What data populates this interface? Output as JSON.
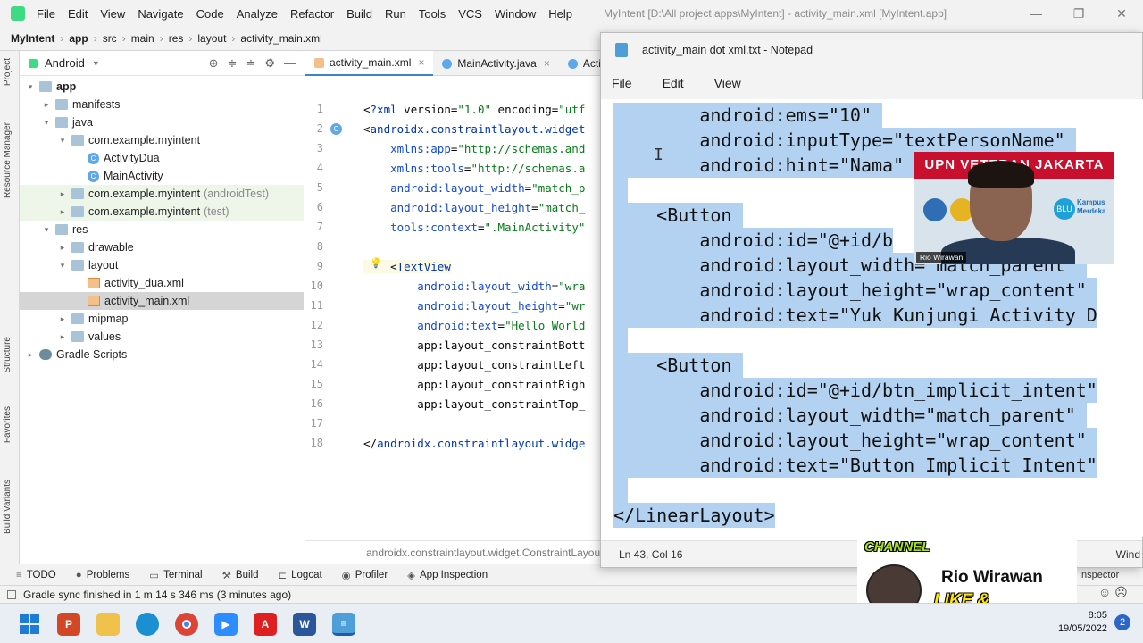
{
  "ide": {
    "menu": [
      "File",
      "Edit",
      "View",
      "Navigate",
      "Code",
      "Analyze",
      "Refactor",
      "Build",
      "Run",
      "Tools",
      "VCS",
      "Window",
      "Help"
    ],
    "window_title": "MyIntent [D:\\All project apps\\MyIntent] - activity_main.xml [MyIntent.app]",
    "breadcrumb": [
      "MyIntent",
      "app",
      "src",
      "main",
      "res",
      "layout",
      "activity_main.xml"
    ],
    "project_view": "Android",
    "tree": [
      {
        "label": "app",
        "depth": 0,
        "arrow": "▾",
        "icon": "folder",
        "bold": true
      },
      {
        "label": "manifests",
        "depth": 1,
        "arrow": "▸",
        "icon": "folder"
      },
      {
        "label": "java",
        "depth": 1,
        "arrow": "▾",
        "icon": "folder"
      },
      {
        "label": "com.example.myintent",
        "depth": 2,
        "arrow": "▾",
        "icon": "folder"
      },
      {
        "label": "ActivityDua",
        "depth": 3,
        "arrow": "",
        "icon": "class"
      },
      {
        "label": "MainActivity",
        "depth": 3,
        "arrow": "",
        "icon": "class"
      },
      {
        "label": "com.example.myintent",
        "suffix": "(androidTest)",
        "depth": 2,
        "arrow": "▸",
        "icon": "folder",
        "hl": true
      },
      {
        "label": "com.example.myintent",
        "suffix": "(test)",
        "depth": 2,
        "arrow": "▸",
        "icon": "folder",
        "hl": true
      },
      {
        "label": "res",
        "depth": 1,
        "arrow": "▾",
        "icon": "folder"
      },
      {
        "label": "drawable",
        "depth": 2,
        "arrow": "▸",
        "icon": "folder"
      },
      {
        "label": "layout",
        "depth": 2,
        "arrow": "▾",
        "icon": "folder"
      },
      {
        "label": "activity_dua.xml",
        "depth": 3,
        "arrow": "",
        "icon": "xml"
      },
      {
        "label": "activity_main.xml",
        "depth": 3,
        "arrow": "",
        "icon": "xml",
        "selected": true
      },
      {
        "label": "mipmap",
        "depth": 2,
        "arrow": "▸",
        "icon": "folder"
      },
      {
        "label": "values",
        "depth": 2,
        "arrow": "▸",
        "icon": "folder"
      },
      {
        "label": "Gradle Scripts",
        "depth": 0,
        "arrow": "▸",
        "icon": "gradle"
      }
    ],
    "tabs": [
      "activity_main.xml",
      "MainActivity.java",
      "Activ"
    ],
    "code_lines": [
      {
        "n": "1",
        "t": "<?xml version=\"1.0\" encoding=\"utf"
      },
      {
        "n": "2",
        "t": "<androidx.constraintlayout.widget"
      },
      {
        "n": "3",
        "t": "    xmlns:app=\"http://schemas.and"
      },
      {
        "n": "4",
        "t": "    xmlns:tools=\"http://schemas.a"
      },
      {
        "n": "5",
        "t": "    android:layout_width=\"match_p"
      },
      {
        "n": "6",
        "t": "    android:layout_height=\"match_"
      },
      {
        "n": "7",
        "t": "    tools:context=\".MainActivity\""
      },
      {
        "n": "8",
        "t": ""
      },
      {
        "n": "9",
        "t": "    <TextView"
      },
      {
        "n": "10",
        "t": "        android:layout_width=\"wra"
      },
      {
        "n": "11",
        "t": "        android:layout_height=\"wr"
      },
      {
        "n": "12",
        "t": "        android:text=\"Hello World"
      },
      {
        "n": "13",
        "t": "        app:layout_constraintBott"
      },
      {
        "n": "14",
        "t": "        app:layout_constraintLeft"
      },
      {
        "n": "15",
        "t": "        app:layout_constraintRigh"
      },
      {
        "n": "16",
        "t": "        app:layout_constraintTop_"
      },
      {
        "n": "17",
        "t": ""
      },
      {
        "n": "18",
        "t": "</androidx.constraintlayout.widge"
      }
    ],
    "editor_crumb": "androidx.constraintlayout.widget.ConstraintLayout",
    "tool_windows": [
      "TODO",
      "Problems",
      "Terminal",
      "Build",
      "Logcat",
      "Profiler",
      "App Inspection"
    ],
    "status": "Gradle sync finished in 1 m 14 s 346 ms (3 minutes ago)",
    "side_labels": [
      "Project",
      "Resource Manager",
      "Structure",
      "Favorites",
      "Build Variants"
    ],
    "inspector_label": "Inspector"
  },
  "notepad": {
    "title": "activity_main dot xml.txt - Notepad",
    "menu": [
      "File",
      "Edit",
      "View"
    ],
    "lines": [
      "        android:ems=\"10\" ",
      "        android:inputType=\"textPersonName\" ",
      "        android:hint=\"Nama\" ",
      "",
      "    <Button ",
      "        android:id=\"@+id/b",
      "        android:layout_width=\"match_parent\" ",
      "        android:layout_height=\"wrap_content\" ",
      "        android:text=\"Yuk Kunjungi Activity D",
      "",
      "    <Button ",
      "        android:id=\"@+id/btn_implicit_intent\"",
      "        android:layout_width=\"match_parent\" ",
      "        android:layout_height=\"wrap_content\" ",
      "        android:text=\"Button Implicit Intent\"",
      "",
      "</LinearLayout>"
    ],
    "status": "Ln 43, Col 16",
    "status_right": "Wind"
  },
  "webcam": {
    "banner": "UPN VETERAN JAKARTA",
    "name_tag": "Rio Wirawan",
    "logo_text": "BLU",
    "kampus_text": "Kampus Merdeka"
  },
  "channel": {
    "tag": "CHANNEL",
    "name": "Rio Wirawan",
    "cta": "LIKE & SUBSCRIBE"
  },
  "taskbar": {
    "time": "8:05",
    "date": "19/05/2022",
    "notifications": "2",
    "apps": [
      "windows-start",
      "powerpoint",
      "file-explorer",
      "edge",
      "chrome",
      "zoom",
      "acrobat",
      "word",
      "notepad"
    ]
  }
}
